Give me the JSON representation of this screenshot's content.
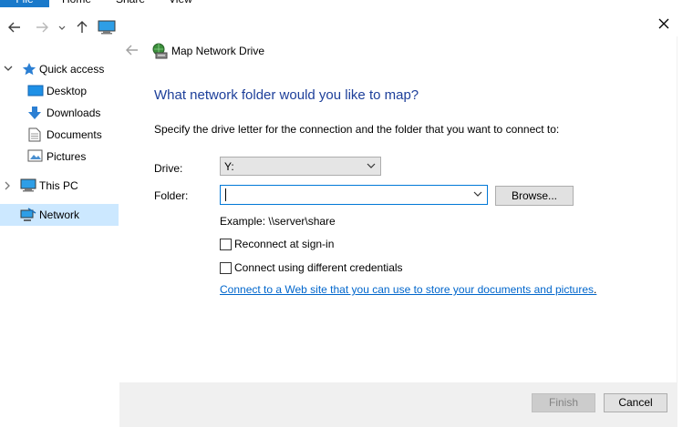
{
  "ribbon": {
    "tabs": [
      "File",
      "Home",
      "Share",
      "View"
    ]
  },
  "sidebar": {
    "items": [
      {
        "label": "Quick access",
        "icon": "star-icon"
      },
      {
        "label": "Desktop",
        "icon": "desktop-icon"
      },
      {
        "label": "Downloads",
        "icon": "download-arrow-icon"
      },
      {
        "label": "Documents",
        "icon": "documents-icon"
      },
      {
        "label": "Pictures",
        "icon": "pictures-icon"
      },
      {
        "label": "This PC",
        "icon": "computer-icon"
      },
      {
        "label": "Network",
        "icon": "network-icon",
        "selected": true
      }
    ]
  },
  "dialog": {
    "title": "Map Network Drive",
    "heading": "What network folder would you like to map?",
    "instruction": "Specify the drive letter for the connection and the folder that you want to connect to:",
    "drive_label": "Drive:",
    "drive_value": "Y:",
    "folder_label": "Folder:",
    "folder_value": "",
    "browse_label": "Browse...",
    "example": "Example: \\\\server\\share",
    "reconnect_label": "Reconnect at sign-in",
    "reconnect_checked": false,
    "credentials_label": "Connect using different credentials",
    "credentials_checked": false,
    "link_text": "Connect to a Web site that you can use to store your documents and pictures",
    "link_suffix": ".",
    "finish_label": "Finish",
    "finish_enabled": false,
    "cancel_label": "Cancel"
  },
  "colors": {
    "accent": "#1979ca",
    "heading": "#1d3f9a",
    "link": "#0066cc",
    "selection": "#cce8ff",
    "focus_border": "#0078d7"
  }
}
